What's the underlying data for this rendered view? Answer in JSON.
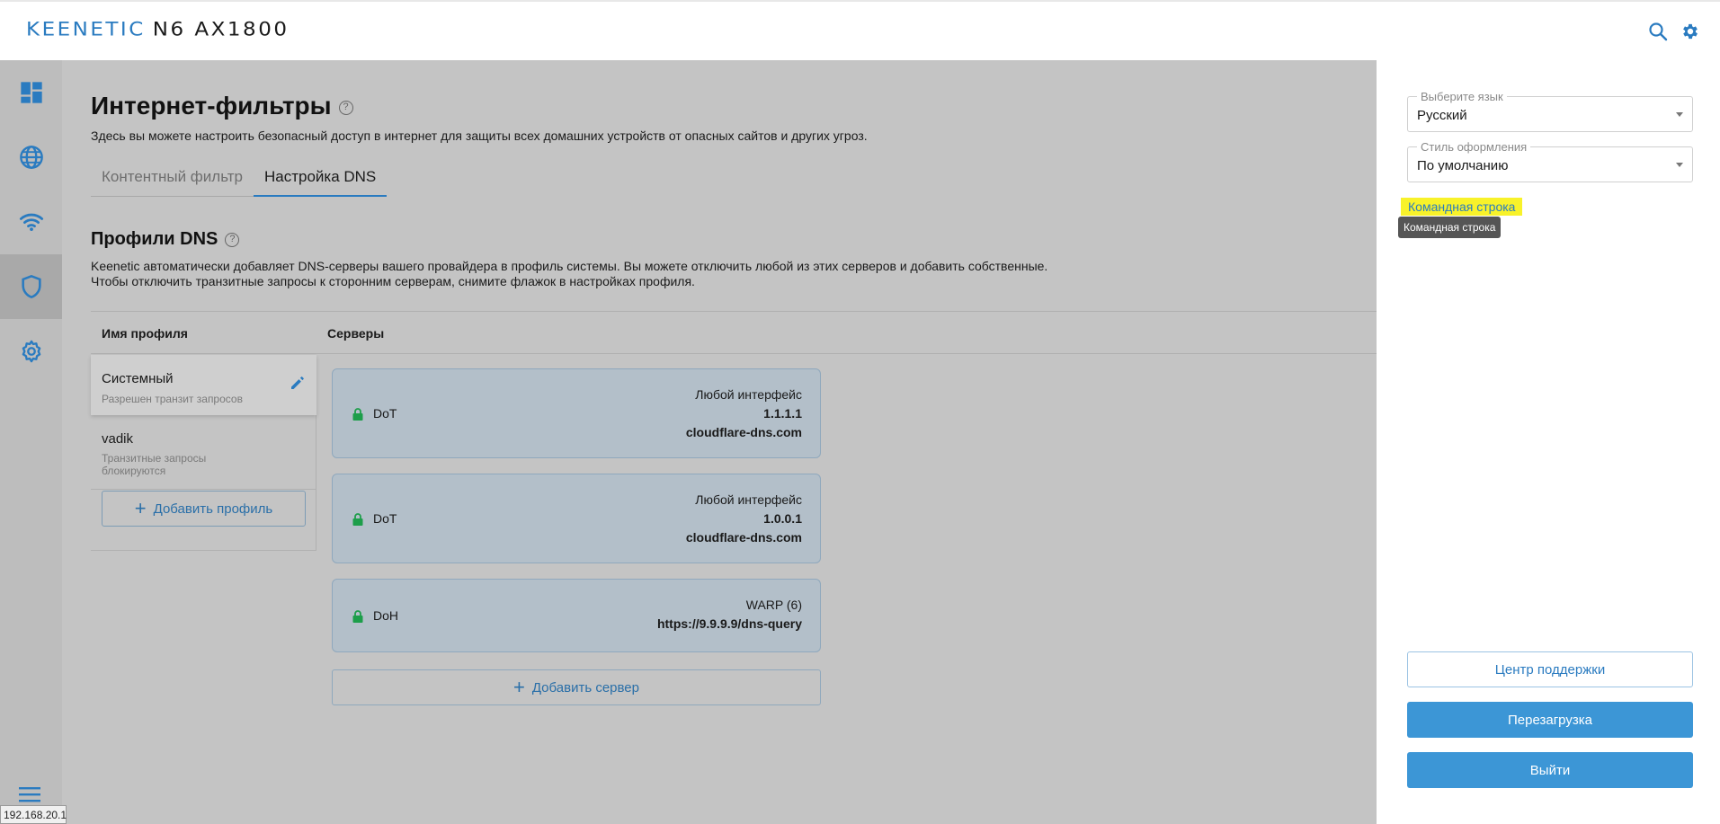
{
  "header": {
    "brand_keenetic": "KEENETIC",
    "brand_model": "N6 AX1800",
    "icons": [
      "search-icon",
      "gear-icon"
    ]
  },
  "sidebar": {
    "items": [
      {
        "icon": "dashboard-icon",
        "active": false
      },
      {
        "icon": "globe-icon",
        "active": false
      },
      {
        "icon": "wifi-icon",
        "active": false
      },
      {
        "icon": "shield-icon",
        "active": true
      },
      {
        "icon": "settings-icon",
        "active": false
      }
    ],
    "menu_icon": "hamburger-icon"
  },
  "page": {
    "title": "Интернет-фильтры",
    "description": "Здесь вы можете настроить безопасный доступ в интернет для защиты всех домашних устройств от опасных сайтов и других угроз.",
    "tabs": [
      {
        "label": "Контентный фильтр",
        "active": false
      },
      {
        "label": "Настройка DNS",
        "active": true
      }
    ]
  },
  "dns_profiles": {
    "title": "Профили DNS",
    "description_line1": "Keenetic автоматически добавляет DNS-серверы вашего провайдера в профиль системы. Вы можете отключить любой из этих серверов и добавить собственные.",
    "description_line2": "Чтобы отключить транзитные запросы к сторонним серверам, снимите флажок в настройках профиля.",
    "col_profile": "Имя профиля",
    "col_servers": "Серверы",
    "profiles": [
      {
        "name": "Системный",
        "sub": "Разрешен транзит запросов"
      },
      {
        "name": "vadik",
        "sub": "Транзитные запросы блокируются"
      }
    ],
    "add_profile": "Добавить профиль",
    "servers": [
      {
        "proto": "DoT",
        "iface": "Любой интерфейс",
        "address": "1.1.1.1",
        "host": "cloudflare-dns.com"
      },
      {
        "proto": "DoT",
        "iface": "Любой интерфейс",
        "address": "1.0.0.1",
        "host": "cloudflare-dns.com"
      },
      {
        "proto": "DoH",
        "iface": "WARP (6)",
        "address": "https://9.9.9.9/dns-query"
      }
    ],
    "add_server": "Добавить сервер"
  },
  "status": {
    "ip": "192.168.20.1"
  },
  "settings_panel": {
    "language_label": "Выберите язык",
    "language_value": "Русский",
    "theme_label": "Стиль оформления",
    "theme_value": "По умолчанию",
    "command_line_link": "Командная строка",
    "command_line_tooltip": "Командная строка",
    "support_button": "Центр поддержки",
    "reboot_button": "Перезагрузка",
    "logout_button": "Выйти"
  },
  "colors": {
    "accent": "#2a7bc0",
    "primary_button": "#3c96d6",
    "highlight": "#f8f22a",
    "overlay": "#c4c4c4"
  }
}
